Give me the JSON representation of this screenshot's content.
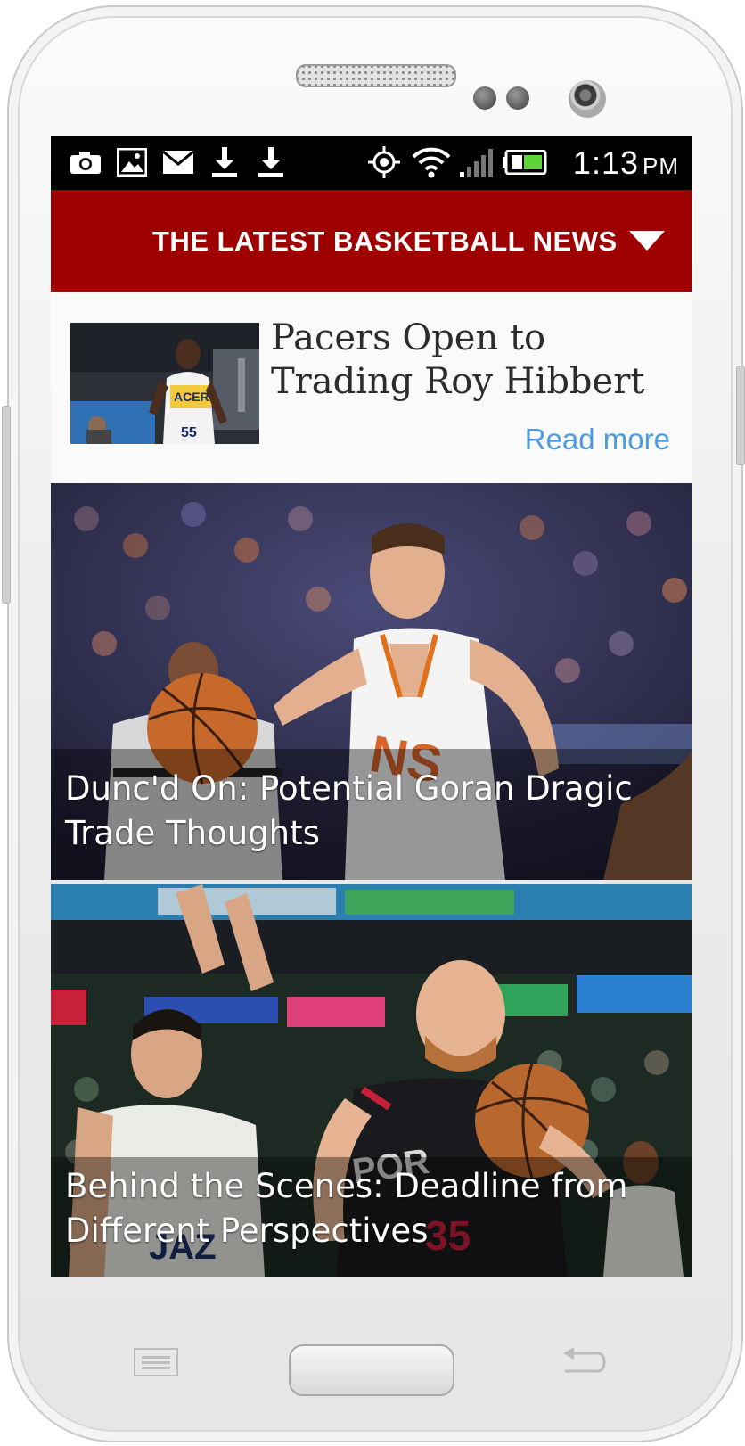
{
  "status_bar": {
    "icons": [
      "camera-icon",
      "image-icon",
      "mail-icon",
      "download-icon",
      "download-icon",
      "gps-icon",
      "wifi-icon",
      "signal-icon",
      "battery-icon"
    ],
    "time": "1:13",
    "ampm": "PM"
  },
  "app_bar": {
    "title": "THE LATEST BASKETBALL NEWS",
    "dropdown_icon": "triangle-down-icon",
    "color": "#9e0000"
  },
  "feed": {
    "featured": {
      "title": "Pacers Open to Trading Roy Hibbert",
      "link_label": "Read more",
      "link_color": "#4a9de2"
    },
    "stories": [
      {
        "caption": "Dunc'd On: Potential Goran Dragic Trade Thoughts"
      },
      {
        "caption": "Behind the Scenes: Deadline from Different Perspectives"
      }
    ]
  },
  "hardware_keys": [
    "menu-icon",
    "home-button",
    "back-icon"
  ]
}
